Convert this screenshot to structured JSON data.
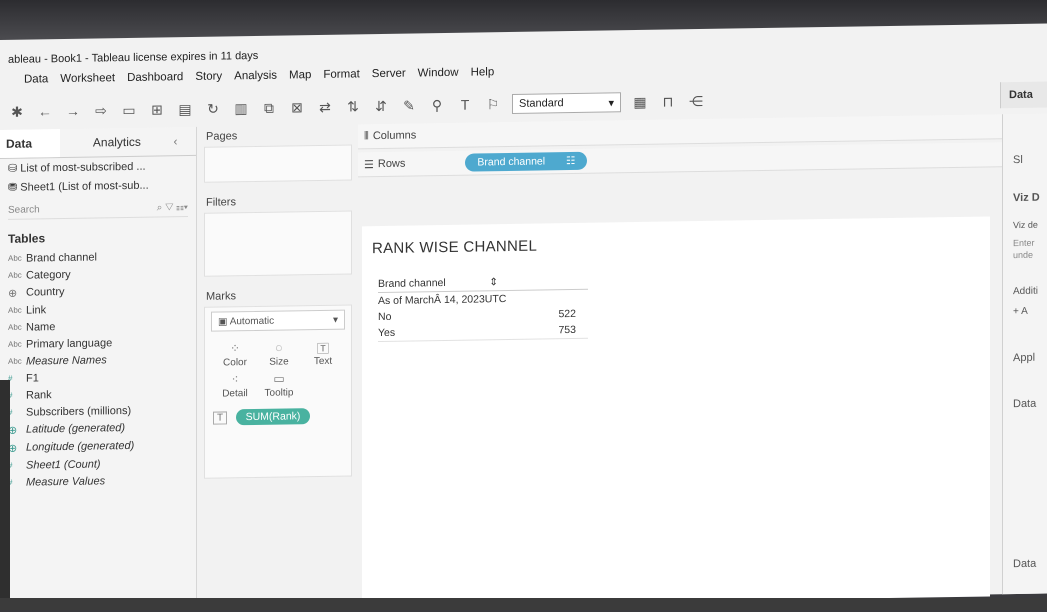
{
  "window": {
    "title": "ableau - Book1 - Tableau license expires in 11 days"
  },
  "menu": [
    "Data",
    "Worksheet",
    "Dashboard",
    "Story",
    "Analysis",
    "Map",
    "Format",
    "Server",
    "Window",
    "Help"
  ],
  "toolbar": {
    "fit_value": "Standard"
  },
  "data_pane": {
    "tab_data": "Data",
    "tab_analytics": "Analytics",
    "datasources": [
      "List of most-subscribed ...",
      "Sheet1 (List of most-sub..."
    ],
    "search_placeholder": "Search",
    "tables_heading": "Tables",
    "dimensions": [
      {
        "type": "Abc",
        "name": "Brand channel"
      },
      {
        "type": "Abc",
        "name": "Category"
      },
      {
        "type": "globe",
        "name": "Country"
      },
      {
        "type": "Abc",
        "name": "Link"
      },
      {
        "type": "Abc",
        "name": "Name"
      },
      {
        "type": "Abc",
        "name": "Primary language"
      },
      {
        "type": "Abc",
        "name": "Measure Names"
      }
    ],
    "measures": [
      {
        "type": "#",
        "name": "F1"
      },
      {
        "type": "#",
        "name": "Rank"
      },
      {
        "type": "#",
        "name": "Subscribers (millions)"
      },
      {
        "type": "globe",
        "name": "Latitude (generated)"
      },
      {
        "type": "globe",
        "name": "Longitude (generated)"
      },
      {
        "type": "#",
        "name": "Sheet1 (Count)"
      },
      {
        "type": "#",
        "name": "Measure Values"
      }
    ]
  },
  "cards": {
    "pages": "Pages",
    "filters": "Filters",
    "marks": "Marks",
    "mark_type": "Automatic",
    "mark_buttons": [
      "Color",
      "Size",
      "Text",
      "Detail",
      "Tooltip"
    ],
    "text_pill": "SUM(Rank)"
  },
  "shelves": {
    "columns": "Columns",
    "rows": "Rows",
    "rows_pill": "Brand channel"
  },
  "view": {
    "title": "RANK WISE CHANNEL",
    "header": "Brand channel",
    "subheader": "As of MarchÂ 14, 2023UTC",
    "rows": [
      {
        "label": "No",
        "value": "522"
      },
      {
        "label": "Yes",
        "value": "753"
      }
    ]
  },
  "right_pane": {
    "tab": "Data",
    "items": [
      "Sl",
      "Viz D",
      "Viz de",
      "Enter",
      "unde",
      "Additi",
      "+ A",
      "Appl",
      "Data",
      "Data"
    ]
  }
}
